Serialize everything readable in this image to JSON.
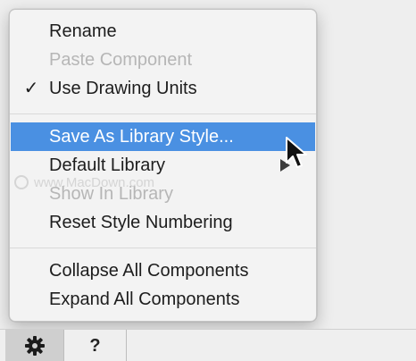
{
  "menu": {
    "items": [
      {
        "label": "Rename",
        "enabled": true,
        "checked": false
      },
      {
        "label": "Paste Component",
        "enabled": false,
        "checked": false
      },
      {
        "label": "Use Drawing Units",
        "enabled": true,
        "checked": true
      },
      {
        "label": "Save As Library Style...",
        "enabled": true,
        "highlighted": true
      },
      {
        "label": "Default Library",
        "enabled": true,
        "has_submenu": true
      },
      {
        "label": "Show In Library",
        "enabled": false
      },
      {
        "label": "Reset Style Numbering",
        "enabled": true
      },
      {
        "label": "Collapse All Components",
        "enabled": true
      },
      {
        "label": "Expand All Components",
        "enabled": true
      }
    ],
    "check_glyph": "✓"
  },
  "watermark": {
    "text": "www.MacDown.com"
  },
  "toolbar": {
    "gear_icon": "gear-icon",
    "help_label": "?"
  },
  "colors": {
    "highlight": "#4a90e2",
    "disabled_text": "#b6b6b6",
    "text": "#1d1d1d"
  }
}
